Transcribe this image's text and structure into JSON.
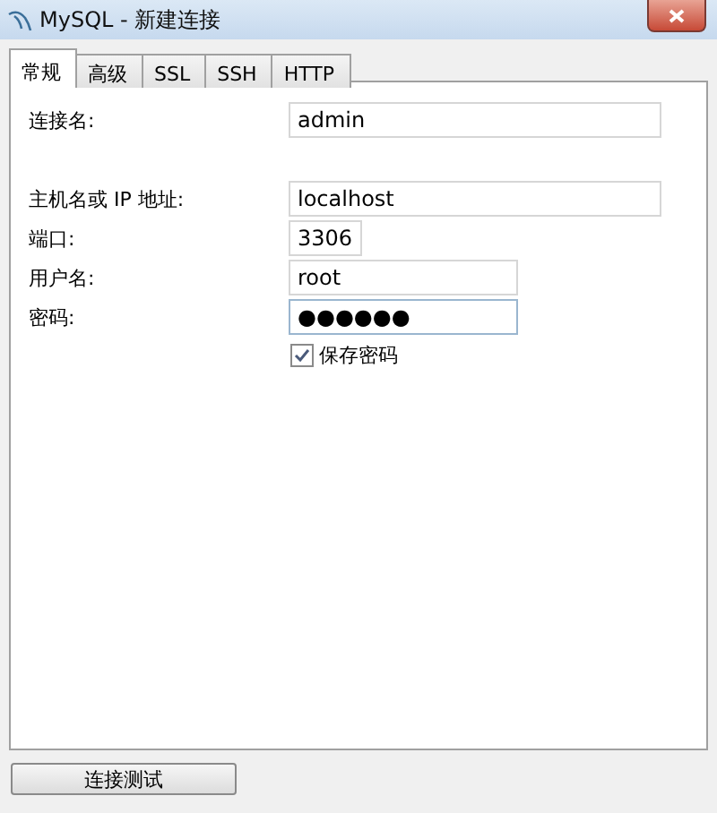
{
  "window": {
    "title": "MySQL - 新建连接"
  },
  "tabs": [
    {
      "label": "常规",
      "selected": true
    },
    {
      "label": "高级",
      "selected": false
    },
    {
      "label": "SSL",
      "selected": false
    },
    {
      "label": "SSH",
      "selected": false
    },
    {
      "label": "HTTP",
      "selected": false
    }
  ],
  "fields": [
    {
      "label": "连接名:",
      "value": "admin",
      "focused": false
    },
    {
      "label": "主机名或 IP 地址:",
      "value": "localhost",
      "focused": false
    },
    {
      "label": "端口:",
      "value": "3306",
      "focused": false
    },
    {
      "label": "用户名:",
      "value": "root",
      "focused": false
    },
    {
      "label": "密码:",
      "value": "●●●●●●",
      "focused": true
    }
  ],
  "save_password": {
    "label": "保存密码",
    "checked": true
  },
  "buttons": [
    "连接测试"
  ]
}
